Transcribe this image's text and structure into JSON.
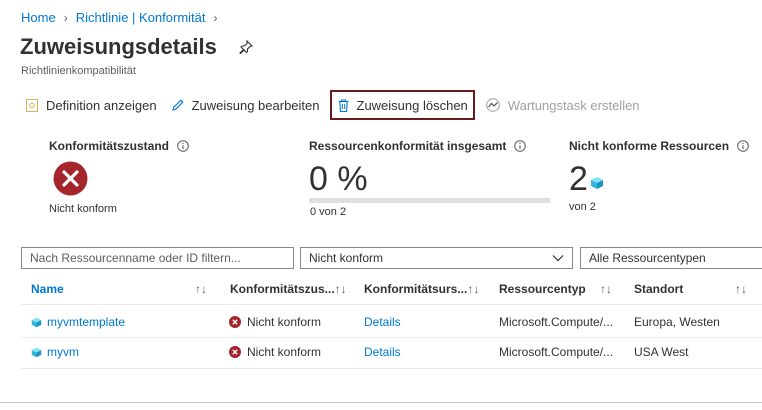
{
  "breadcrumb": {
    "home": "Home",
    "policy": "Richtlinie | Konformität"
  },
  "page": {
    "title": "Zuweisungsdetails",
    "subtitle": "Richtlinienkompatibilität"
  },
  "toolbar": {
    "definition": "Definition anzeigen",
    "edit": "Zuweisung bearbeiten",
    "delete": "Zuweisung löschen",
    "remediation": "Wartungstask erstellen"
  },
  "summary": {
    "state_label": "Konformitätszustand",
    "state_value": "Nicht konform",
    "resource_label": "Ressourcenkonformität insgesamt",
    "resource_pct": "0 %",
    "resource_sub": "0 von 2",
    "resource_fraction": 0,
    "noncompliant_label": "Nicht konforme Ressourcen",
    "noncompliant_count": "2",
    "noncompliant_sub": "von 2"
  },
  "filters": {
    "search_placeholder": "Nach Ressourcenname oder ID filtern...",
    "state_select": "Nicht konform",
    "type_select": "Alle Ressourcentypen"
  },
  "table": {
    "headers": [
      "Name",
      "Konformitätszus...",
      "Konformitätsurs...",
      "Ressourcentyp",
      "Standort"
    ],
    "rows": [
      {
        "name": "myvmtemplate",
        "state": "Nicht konform",
        "reason": "Details",
        "type": "Microsoft.Compute/...",
        "location": "Europa, Westen"
      },
      {
        "name": "myvm",
        "state": "Nicht konform",
        "reason": "Details",
        "type": "Microsoft.Compute/...",
        "location": "USA West"
      }
    ]
  },
  "colors": {
    "accent": "#0078d4",
    "error": "#a4262c",
    "highlight_border": "#6b1a1a"
  }
}
